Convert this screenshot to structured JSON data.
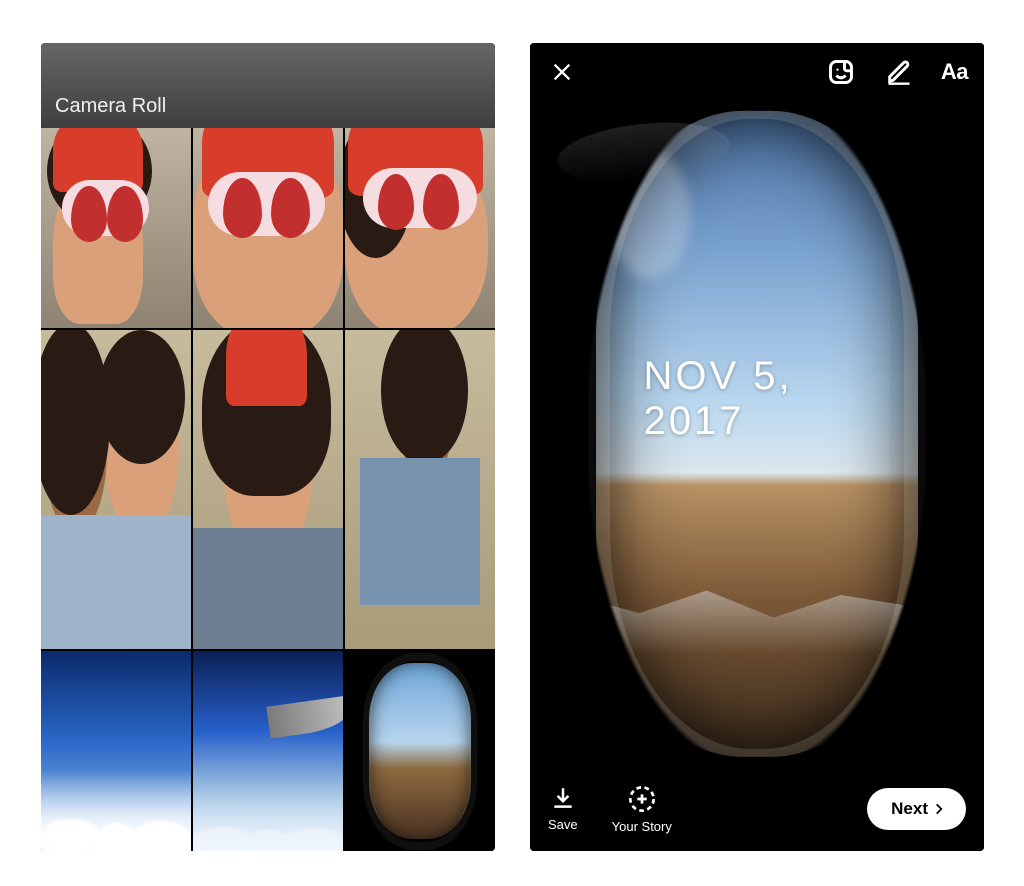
{
  "left": {
    "header_title": "Camera Roll"
  },
  "right": {
    "date_stamp": "NOV 5, 2017",
    "save_label": "Save",
    "your_story_label": "Your Story",
    "next_label": "Next",
    "text_tool_label": "Aa"
  }
}
